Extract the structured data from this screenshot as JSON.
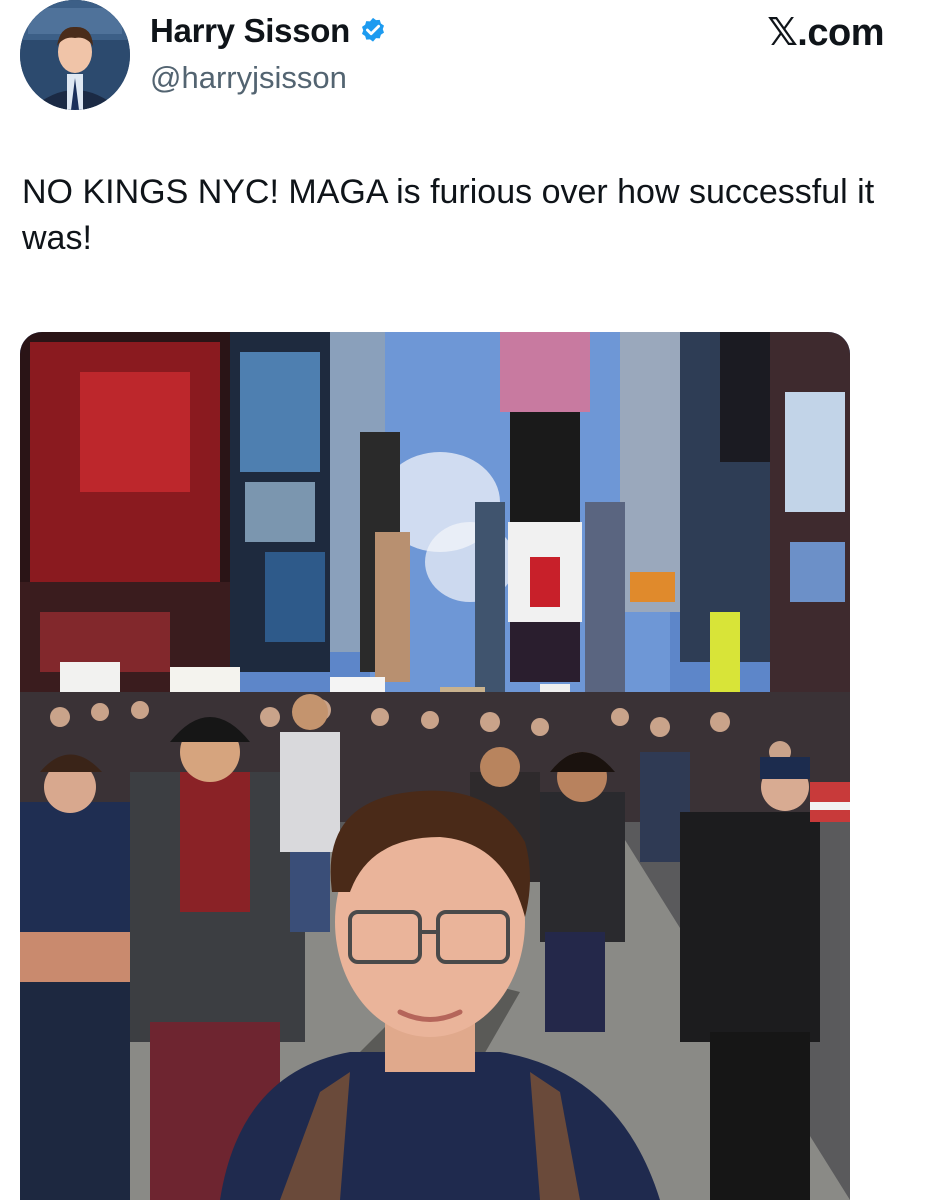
{
  "author": {
    "display_name": "Harry Sisson",
    "handle": "@harryjsisson",
    "verified": true,
    "avatar_icon": "profile-photo"
  },
  "brand": {
    "label": "𝕏.com"
  },
  "tweet": {
    "text": "NO KINGS NYC! MAGA is furious over how successful it was!"
  },
  "media": {
    "type": "photo",
    "icon": "selfie-times-square-crowd"
  },
  "colors": {
    "text": "#0f1419",
    "secondary_text": "#536471",
    "verified_badge": "#1d9bf0"
  }
}
